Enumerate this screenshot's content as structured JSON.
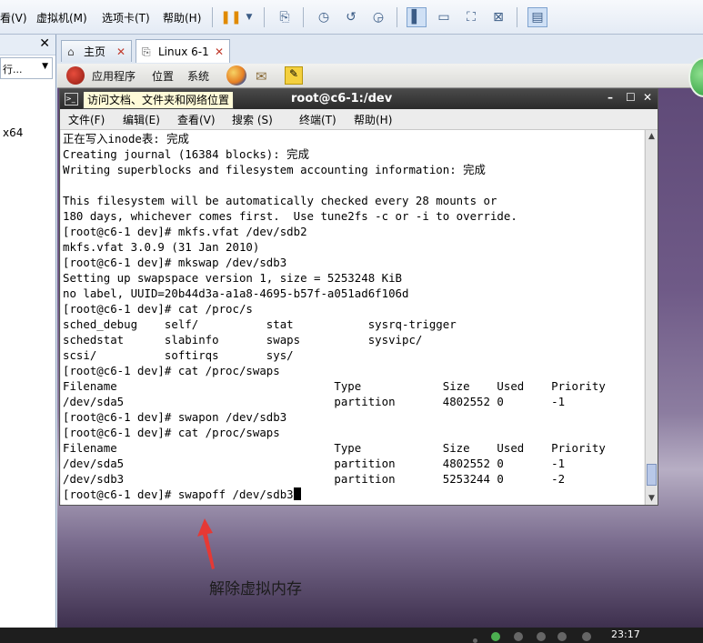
{
  "menubar": {
    "items": [
      "看(V)",
      "虚拟机(M)",
      "选项卡(T)",
      "帮助(H)"
    ]
  },
  "left_panel": {
    "close": "✕",
    "search_text": "行...",
    "item": "x64"
  },
  "tabs": [
    {
      "label": "主页",
      "close": "✕"
    },
    {
      "label": "Linux 6-1",
      "close": "✕"
    }
  ],
  "guest_panel": {
    "applications": "应用程序",
    "places": "位置",
    "system": "系统"
  },
  "terminal": {
    "title": "root@c6-1:/dev",
    "tooltip": "访问文档、文件夹和网络位置",
    "menu": [
      "文件(F)",
      "编辑(E)",
      "查看(V)",
      "搜索 (S)",
      "终端(T)",
      "帮助(H)"
    ],
    "lines": [
      "正在写入inode表: 完成",
      "Creating journal (16384 blocks): 完成",
      "Writing superblocks and filesystem accounting information: 完成",
      "",
      "This filesystem will be automatically checked every 28 mounts or",
      "180 days, whichever comes first.  Use tune2fs -c or -i to override.",
      "[root@c6-1 dev]# mkfs.vfat /dev/sdb2",
      "mkfs.vfat 3.0.9 (31 Jan 2010)",
      "[root@c6-1 dev]# mkswap /dev/sdb3",
      "Setting up swapspace version 1, size = 5253248 KiB",
      "no label, UUID=20b44d3a-a1a8-4695-b57f-a051ad6f106d",
      "[root@c6-1 dev]# cat /proc/s",
      "sched_debug    self/          stat           sysrq-trigger",
      "schedstat      slabinfo       swaps          sysvipc/",
      "scsi/          softirqs       sys/",
      "[root@c6-1 dev]# cat /proc/swaps",
      "Filename                                Type            Size    Used    Priority",
      "/dev/sda5                               partition       4802552 0       -1",
      "[root@c6-1 dev]# swapon /dev/sdb3",
      "[root@c6-1 dev]# cat /proc/swaps",
      "Filename                                Type            Size    Used    Priority",
      "/dev/sda5                               partition       4802552 0       -1",
      "/dev/sdb3                               partition       5253244 0       -2"
    ],
    "prompt_line": "[root@c6-1 dev]# swapoff /dev/sdb3"
  },
  "annotation": {
    "text": "解除虚拟内存",
    "arrow_color": "#e53935"
  },
  "taskbar": {
    "clock": "23:17"
  }
}
